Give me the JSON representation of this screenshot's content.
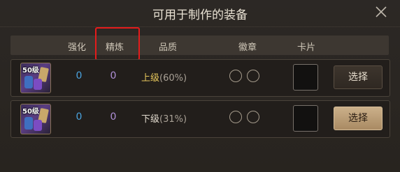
{
  "dialog": {
    "title": "可用于制作的装备",
    "close_icon": "close-icon"
  },
  "columns": {
    "enhance": "强化",
    "refine": "精炼",
    "quality": "品质",
    "badge": "徽章",
    "card": "卡片"
  },
  "rows": [
    {
      "level": "50级",
      "enhance": "0",
      "refine": "0",
      "quality_level": "上级",
      "quality_pct": "(60%)",
      "button": "选择"
    },
    {
      "level": "50级",
      "enhance": "0",
      "refine": "0",
      "quality_level": "下级",
      "quality_pct": "(31%)",
      "button": "选择"
    }
  ],
  "colors": {
    "enhance": "#4aa3df",
    "refine": "#b090d8",
    "highlight": "#e51b1b"
  }
}
